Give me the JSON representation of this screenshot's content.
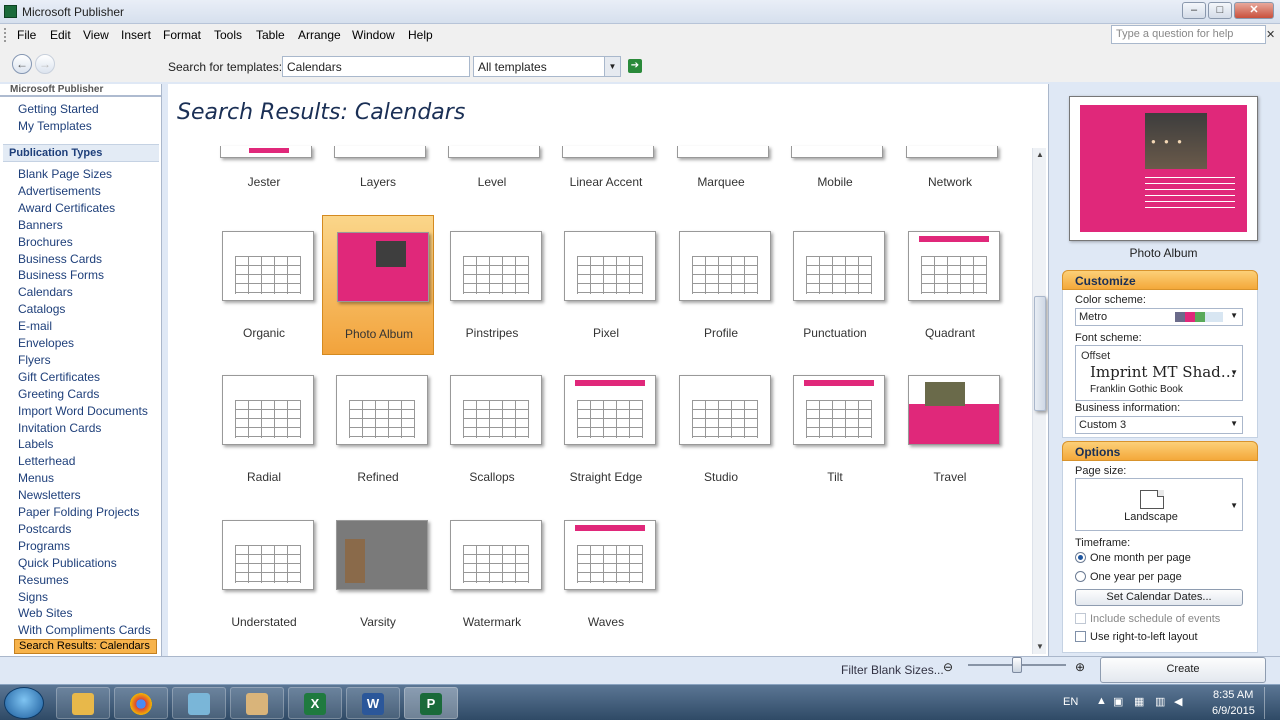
{
  "window": {
    "title": "Microsoft Publisher"
  },
  "menu": [
    "File",
    "Edit",
    "View",
    "Insert",
    "Format",
    "Tools",
    "Table",
    "Arrange",
    "Window",
    "Help"
  ],
  "help_placeholder": "Type a question for help",
  "search": {
    "label": "Search for templates:",
    "value": "Calendars",
    "scope": "All templates"
  },
  "left": {
    "header": "Microsoft Publisher",
    "top_items": [
      "Getting Started",
      "My Templates"
    ],
    "section": "Publication Types",
    "items": [
      "Blank Page Sizes",
      "Advertisements",
      "Award Certificates",
      "Banners",
      "Brochures",
      "Business Cards",
      "Business Forms",
      "Calendars",
      "Catalogs",
      "E-mail",
      "Envelopes",
      "Flyers",
      "Gift Certificates",
      "Greeting Cards",
      "Import Word Documents",
      "Invitation Cards",
      "Labels",
      "Letterhead",
      "Menus",
      "Newsletters",
      "Paper Folding Projects",
      "Postcards",
      "Programs",
      "Quick Publications",
      "Resumes",
      "Signs",
      "Web Sites",
      "With Compliments Cards"
    ],
    "selected": "Search Results: Calendars"
  },
  "center": {
    "title": "Search Results: Calendars",
    "row0": [
      "Jester",
      "Layers",
      "Level",
      "Linear Accent",
      "Marquee",
      "Mobile",
      "Network"
    ],
    "row1": [
      "Organic",
      "Photo Album",
      "Pinstripes",
      "Pixel",
      "Profile",
      "Punctuation",
      "Quadrant"
    ],
    "row2": [
      "Radial",
      "Refined",
      "Scallops",
      "Straight Edge",
      "Studio",
      "Tilt",
      "Travel"
    ],
    "row3": [
      "Understated",
      "Varsity",
      "Watermark",
      "Waves"
    ],
    "selected": "Photo Album"
  },
  "right": {
    "preview_label": "Photo Album",
    "customize": "Customize",
    "color_scheme_label": "Color scheme:",
    "color_scheme": "Metro",
    "swatches": [
      "#e0287a",
      "#6b6b8a",
      "#5aaa5a",
      "#d8e6f2"
    ],
    "font_scheme_label": "Font scheme:",
    "font_scheme_name": "Offset",
    "font_primary": "Imprint MT Shad…",
    "font_secondary": "Franklin Gothic Book",
    "business_label": "Business information:",
    "business_value": "Custom 3",
    "options": "Options",
    "page_size_label": "Page size:",
    "page_size": "Landscape",
    "timeframe_label": "Timeframe:",
    "timeframe_options": [
      "One month per page",
      "One year per page"
    ],
    "timeframe_selected": 0,
    "set_dates": "Set Calendar Dates...",
    "include_schedule": "Include schedule of events",
    "rtl": "Use right-to-left layout"
  },
  "status": {
    "filter": "Filter Blank Sizes...",
    "create": "Create"
  },
  "tray": {
    "lang": "EN",
    "time": "8:35 AM",
    "date": "6/9/2015"
  }
}
